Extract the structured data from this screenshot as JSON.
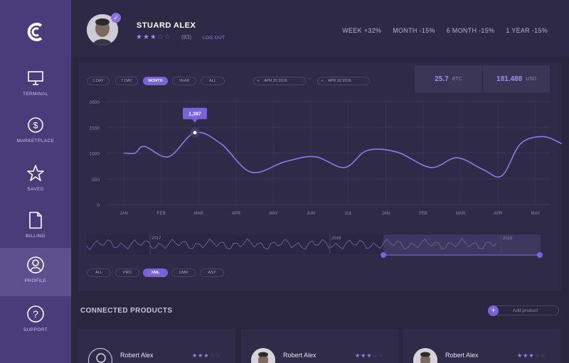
{
  "sidebar": {
    "items": [
      {
        "label": "TERMINAL",
        "icon": "monitor-icon"
      },
      {
        "label": "MARKETPLACE",
        "icon": "dollar-icon"
      },
      {
        "label": "SAVED",
        "icon": "star-icon"
      },
      {
        "label": "BILLING",
        "icon": "document-icon"
      },
      {
        "label": "PROFILE",
        "icon": "user-icon"
      },
      {
        "label": "SUPPORT",
        "icon": "question-icon"
      }
    ],
    "active": "PROFILE"
  },
  "header": {
    "user_name": "STUARD ALEX",
    "rating_stars": 3,
    "rating_max": 5,
    "rating_count": "(83)",
    "logout_label": "LOG OUT",
    "stats": [
      "WEEK +32%",
      "MONTH -15%",
      "6 MONTH -15%",
      "1 YEAR -15%"
    ]
  },
  "chart_controls": {
    "ranges": [
      "1 DAY",
      "7 DAY",
      "MONTH",
      "YEAR",
      "ALL"
    ],
    "active_range": "MONTH",
    "date_from": "APR 20 2016",
    "date_to": "APR 30 2016",
    "formats": [
      "ALL",
      "PRO",
      "XML",
      "DMR",
      "ASY"
    ],
    "active_format": "XML"
  },
  "prices": {
    "btc_value": "25.7",
    "btc_label": "BTC",
    "usd_value": "181.488",
    "usd_label": "USD"
  },
  "chart_data": {
    "type": "line",
    "categories": [
      "JAN",
      "FEB",
      "MAR",
      "APR",
      "MAY",
      "JUN",
      "JUL",
      "JAN",
      "FEB",
      "MAR",
      "APR",
      "MAY"
    ],
    "yticks": [
      "2000",
      "1500",
      "1000",
      "500",
      "0"
    ],
    "ylim": [
      0,
      2000
    ],
    "series": [
      {
        "x": [
          0,
          0.3,
          0.55,
          1.2,
          1.9,
          2.6,
          3.4,
          4.3,
          5.1,
          5.9,
          6.5,
          7.3,
          8.2,
          8.9,
          9.6,
          10.1,
          10.6,
          11.2,
          11.7
        ],
        "y": [
          1000,
          1000,
          1130,
          930,
          1397,
          1180,
          630,
          830,
          930,
          720,
          1050,
          1020,
          720,
          910,
          680,
          560,
          1180,
          1320,
          1180
        ]
      }
    ],
    "highlight": {
      "label": "1,397",
      "value": 1397
    },
    "color": "#9079e6"
  },
  "mini_timeline": {
    "years": [
      "2017",
      "2018",
      "2019"
    ]
  },
  "connected": {
    "title": "CONNECTED PRODUCTS",
    "add_label": "Add product",
    "products": [
      {
        "name": "Robert Alex",
        "stars": 3
      },
      {
        "name": "Robert Alex",
        "stars": 3
      },
      {
        "name": "Robert Alex",
        "stars": 3
      }
    ]
  }
}
